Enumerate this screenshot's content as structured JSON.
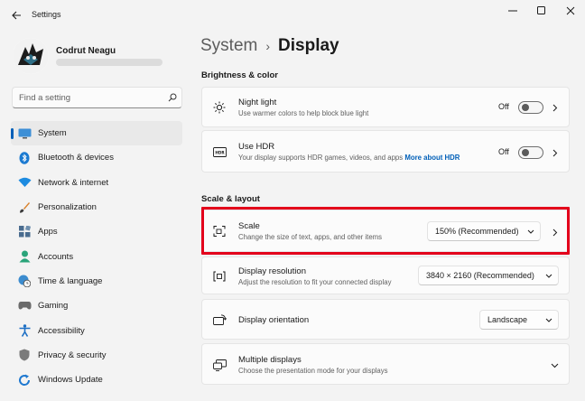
{
  "window": {
    "title": "Settings"
  },
  "profile": {
    "name": "Codrut Neagu"
  },
  "search": {
    "placeholder": "Find a setting"
  },
  "nav": [
    {
      "label": "System",
      "icon": "system-icon",
      "active": true
    },
    {
      "label": "Bluetooth & devices",
      "icon": "bluetooth-icon"
    },
    {
      "label": "Network & internet",
      "icon": "wifi-icon"
    },
    {
      "label": "Personalization",
      "icon": "brush-icon"
    },
    {
      "label": "Apps",
      "icon": "apps-icon"
    },
    {
      "label": "Accounts",
      "icon": "accounts-icon"
    },
    {
      "label": "Time & language",
      "icon": "globe-clock-icon"
    },
    {
      "label": "Gaming",
      "icon": "gamepad-icon"
    },
    {
      "label": "Accessibility",
      "icon": "accessibility-icon"
    },
    {
      "label": "Privacy & security",
      "icon": "shield-icon"
    },
    {
      "label": "Windows Update",
      "icon": "update-icon"
    }
  ],
  "breadcrumb": {
    "parent": "System",
    "separator": "›",
    "current": "Display"
  },
  "brightness_section": {
    "title": "Brightness & color",
    "night_light": {
      "title": "Night light",
      "desc": "Use warmer colors to help block blue light",
      "state": "Off"
    },
    "hdr": {
      "title": "Use HDR",
      "desc": "Your display supports HDR games, videos, and apps",
      "link": "More about HDR",
      "state": "Off",
      "icon_text": "HDR"
    }
  },
  "scale_section": {
    "title": "Scale & layout",
    "scale": {
      "title": "Scale",
      "desc": "Change the size of text, apps, and other items",
      "value": "150% (Recommended)"
    },
    "resolution": {
      "title": "Display resolution",
      "desc": "Adjust the resolution to fit your connected display",
      "value": "3840 × 2160 (Recommended)"
    },
    "orientation": {
      "title": "Display orientation",
      "value": "Landscape"
    },
    "multiple": {
      "title": "Multiple displays",
      "desc": "Choose the presentation mode for your displays"
    }
  },
  "colors": {
    "accent": "#005fb8",
    "highlight_border": "#e3001b"
  }
}
